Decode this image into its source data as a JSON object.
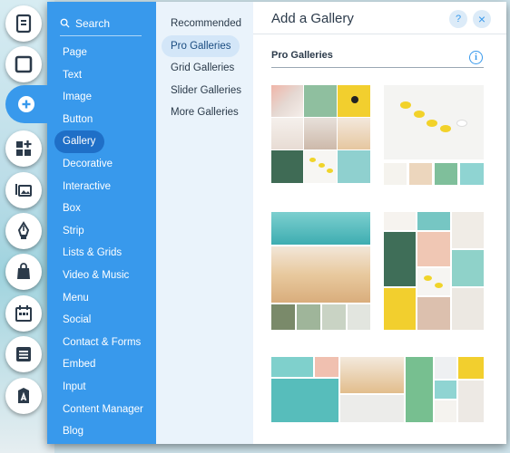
{
  "search": {
    "label": "Search"
  },
  "categories": [
    {
      "label": "Page"
    },
    {
      "label": "Text"
    },
    {
      "label": "Image"
    },
    {
      "label": "Button"
    },
    {
      "label": "Gallery",
      "active": true
    },
    {
      "label": "Decorative"
    },
    {
      "label": "Interactive"
    },
    {
      "label": "Box"
    },
    {
      "label": "Strip"
    },
    {
      "label": "Lists & Grids"
    },
    {
      "label": "Video & Music"
    },
    {
      "label": "Menu"
    },
    {
      "label": "Social"
    },
    {
      "label": "Contact & Forms"
    },
    {
      "label": "Embed"
    },
    {
      "label": "Input"
    },
    {
      "label": "Content Manager"
    },
    {
      "label": "Blog"
    }
  ],
  "subcategories": [
    {
      "label": "Recommended"
    },
    {
      "label": "Pro Galleries",
      "active": true
    },
    {
      "label": "Grid Galleries"
    },
    {
      "label": "Slider Galleries"
    },
    {
      "label": "More Galleries"
    }
  ],
  "panel": {
    "title": "Add a Gallery",
    "help_icon": "?",
    "close_icon": "×",
    "section_title": "Pro Galleries",
    "info_icon": "i"
  },
  "rail_icons": [
    "pages-icon",
    "background-icon",
    "add-icon",
    "add-apps-icon",
    "media-icon",
    "pen-icon",
    "store-icon",
    "bookings-icon",
    "list-icon",
    "text-style-icon"
  ],
  "colors": {
    "accent": "#3899ec",
    "active_category": "#1f6fc7",
    "sub_panel": "#eaf3fb"
  }
}
